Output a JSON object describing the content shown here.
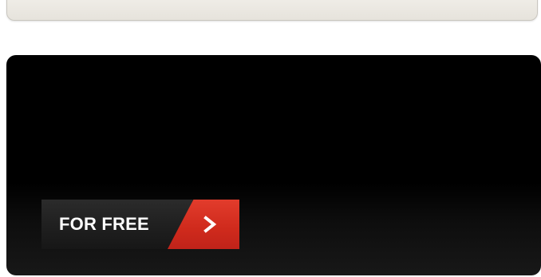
{
  "cta": {
    "label": "FOR FREE"
  },
  "icons": {
    "arrow": "chevron-right-icon"
  },
  "colors": {
    "panel": "#000000",
    "button_dark": "#222222",
    "button_accent": "#d42f20",
    "text": "#ffffff"
  }
}
